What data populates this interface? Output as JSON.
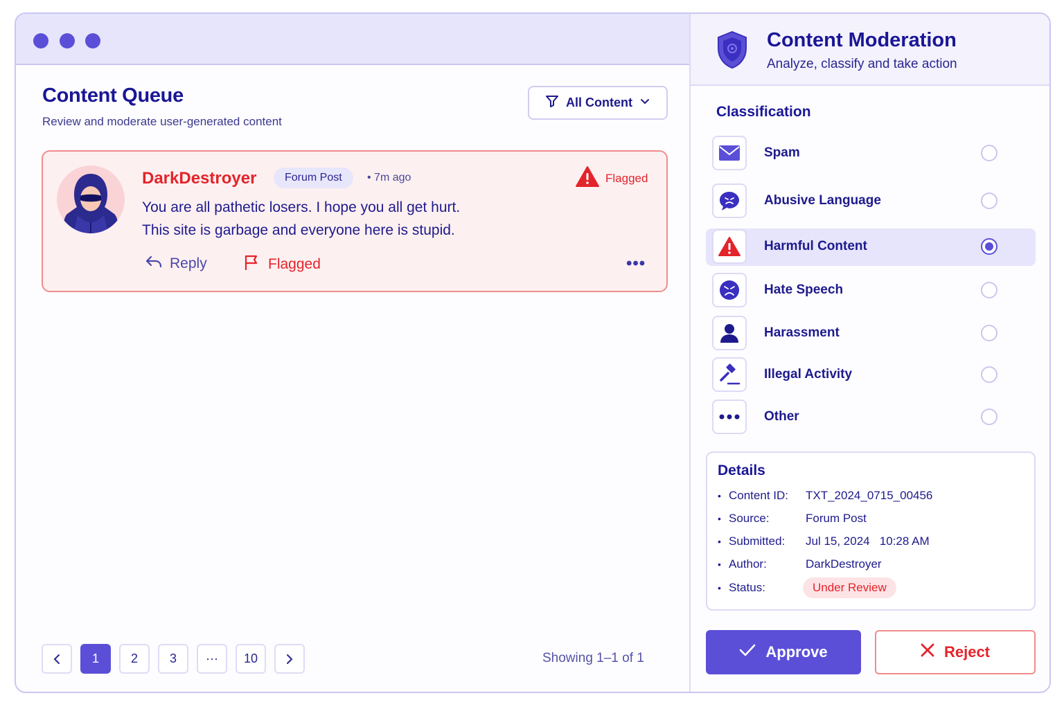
{
  "queue": {
    "title": "Content Queue",
    "subtitle": "Review and moderate user-generated content",
    "filter_label": "All Content",
    "post": {
      "username": "DarkDestroyer",
      "type": "Forum Post",
      "time": "• 7m ago",
      "status": "Flagged",
      "message_line1": "You are all pathetic losers. I hope you all get hurt.",
      "message_line2": "This site is garbage and everyone here is stupid.",
      "reply_label": "Reply",
      "flagged_label": "Flagged"
    },
    "pagination": {
      "pages": [
        "1",
        "2",
        "3",
        "···",
        "10"
      ],
      "active": "1",
      "showing": "Showing 1–1 of 1"
    }
  },
  "moderation": {
    "title": "Content Moderation",
    "subtitle": "Analyze, classify and take action",
    "classification_title": "Classification",
    "options": [
      {
        "label": "Spam",
        "icon": "envelope-icon",
        "selected": false
      },
      {
        "label": "Abusive Language",
        "icon": "angry-chat-icon",
        "selected": false
      },
      {
        "label": "Harmful Content",
        "icon": "warning-triangle-icon",
        "selected": true
      },
      {
        "label": "Hate Speech",
        "icon": "angry-face-icon",
        "selected": false
      },
      {
        "label": "Harassment",
        "icon": "person-icon",
        "selected": false
      },
      {
        "label": "Illegal Activity",
        "icon": "gavel-icon",
        "selected": false
      },
      {
        "label": "Other",
        "icon": "more-dots-icon",
        "selected": false
      }
    ],
    "details": {
      "title": "Details",
      "rows": [
        {
          "key": "Content ID:",
          "value": "TXT_2024_0715_00456"
        },
        {
          "key": "Source:",
          "value": "Forum Post"
        },
        {
          "key": "Submitted:",
          "value": "Jul 15, 2024   10:28 AM"
        },
        {
          "key": "Author:",
          "value": "DarkDestroyer"
        },
        {
          "key": "Status:",
          "value": "Under Review"
        }
      ]
    },
    "approve_label": "Approve",
    "reject_label": "Reject"
  },
  "colors": {
    "accent": "#5b4fd8",
    "danger": "#e3242b",
    "text": "#1e1a8c"
  }
}
